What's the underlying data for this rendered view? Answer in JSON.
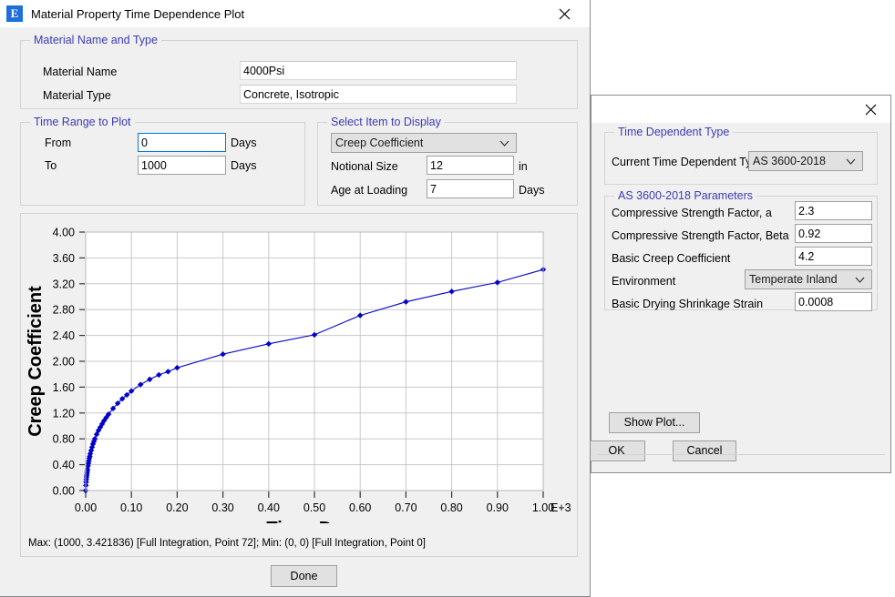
{
  "plot_window": {
    "title": "Material Property Time Dependence Plot",
    "icon": "etabs-e-icon",
    "icon_letter": "E",
    "close_icon": "close-icon",
    "material_group": {
      "legend": "Material Name and Type",
      "name_label": "Material Name",
      "name_value": "4000Psi",
      "type_label": "Material Type",
      "type_value": "Concrete, Isotropic"
    },
    "time_range_group": {
      "legend": "Time Range to Plot",
      "from_label": "From",
      "from_value": "0",
      "from_unit": "Days",
      "to_label": "To",
      "to_value": "1000",
      "to_unit": "Days"
    },
    "select_item_group": {
      "legend": "Select Item to Display",
      "item_value": "Creep Coefficient",
      "notional_label": "Notional Size",
      "notional_value": "12",
      "notional_unit": "in",
      "age_label": "Age at Loading",
      "age_value": "7",
      "age_unit": "Days"
    },
    "status_line": "Max: (1000, 3.421836)  [Full Integration, Point 72];   Min: (0, 0)  [Full Integration, Point 0]",
    "done_label": "Done"
  },
  "params_window": {
    "close_icon": "close-icon",
    "type_group": {
      "legend": "Time Dependent Type",
      "current_label": "Current Time Dependent Type",
      "current_value": "AS 3600-2018"
    },
    "params_group": {
      "legend": "AS 3600-2018 Parameters",
      "rows": [
        {
          "label": "Compressive Strength Factor, a",
          "value": "2.3",
          "kind": "text"
        },
        {
          "label": "Compressive Strength Factor, Beta",
          "value": "0.92",
          "kind": "text"
        },
        {
          "label": "Basic Creep Coefficient",
          "value": "4.2",
          "kind": "text"
        },
        {
          "label": "Environment",
          "value": "Temperate Inland",
          "kind": "combo"
        },
        {
          "label": "Basic Drying Shrinkage Strain",
          "value": "0.0008",
          "kind": "text"
        }
      ]
    },
    "show_plot_label": "Show Plot...",
    "ok_label": "OK",
    "cancel_label": "Cancel"
  },
  "colors": {
    "series": "#0000cc",
    "grid": "#c8c8c8",
    "axis": "#6e6e6e",
    "group_legend": "#3b3bb5",
    "accent": "#1e6fd9"
  },
  "chart_data": {
    "type": "line",
    "title": "",
    "xlabel": "Time, Days",
    "ylabel": "Creep Coefficient",
    "x_exponent_label": "E+3",
    "xlim": [
      0,
      1000
    ],
    "ylim": [
      0,
      4.0
    ],
    "grid": true,
    "legend": null,
    "x_tick_labels": [
      "0.00",
      "0.10",
      "0.20",
      "0.30",
      "0.40",
      "0.50",
      "0.60",
      "0.70",
      "0.80",
      "0.90",
      "1.00"
    ],
    "x_tick_values": [
      0,
      100,
      200,
      300,
      400,
      500,
      600,
      700,
      800,
      900,
      1000
    ],
    "y_tick_labels": [
      "0.00",
      "0.40",
      "0.80",
      "1.20",
      "1.60",
      "2.00",
      "2.40",
      "2.80",
      "3.20",
      "3.60",
      "4.00"
    ],
    "y_tick_values": [
      0,
      0.4,
      0.8,
      1.2,
      1.6,
      2.0,
      2.4,
      2.8,
      3.2,
      3.6,
      4.0
    ],
    "series": [
      {
        "name": "Creep Coefficient",
        "marker": "diamond",
        "x": [
          0,
          0.5,
          1,
          1.5,
          2,
          2.5,
          3,
          3.5,
          4,
          5,
          6,
          7,
          8,
          9,
          10,
          12,
          14,
          16,
          18,
          20,
          24,
          28,
          32,
          36,
          40,
          45,
          50,
          60,
          70,
          80,
          90,
          100,
          120,
          140,
          160,
          180,
          200,
          300,
          400,
          500,
          600,
          700,
          800,
          900,
          1000
        ],
        "y": [
          0.0,
          0.08,
          0.13,
          0.17,
          0.21,
          0.24,
          0.27,
          0.3,
          0.33,
          0.38,
          0.42,
          0.46,
          0.5,
          0.53,
          0.57,
          0.62,
          0.67,
          0.72,
          0.76,
          0.8,
          0.87,
          0.93,
          0.98,
          1.03,
          1.08,
          1.13,
          1.18,
          1.27,
          1.35,
          1.42,
          1.48,
          1.54,
          1.64,
          1.72,
          1.79,
          1.84,
          1.9,
          2.11,
          2.27,
          2.41,
          2.71,
          2.92,
          3.08,
          3.22,
          3.42
        ]
      }
    ],
    "annotations": {
      "max": "Max: (1000, 3.421836)  [Full Integration, Point 72]",
      "min": "Min: (0, 0)  [Full Integration, Point 0]"
    }
  }
}
